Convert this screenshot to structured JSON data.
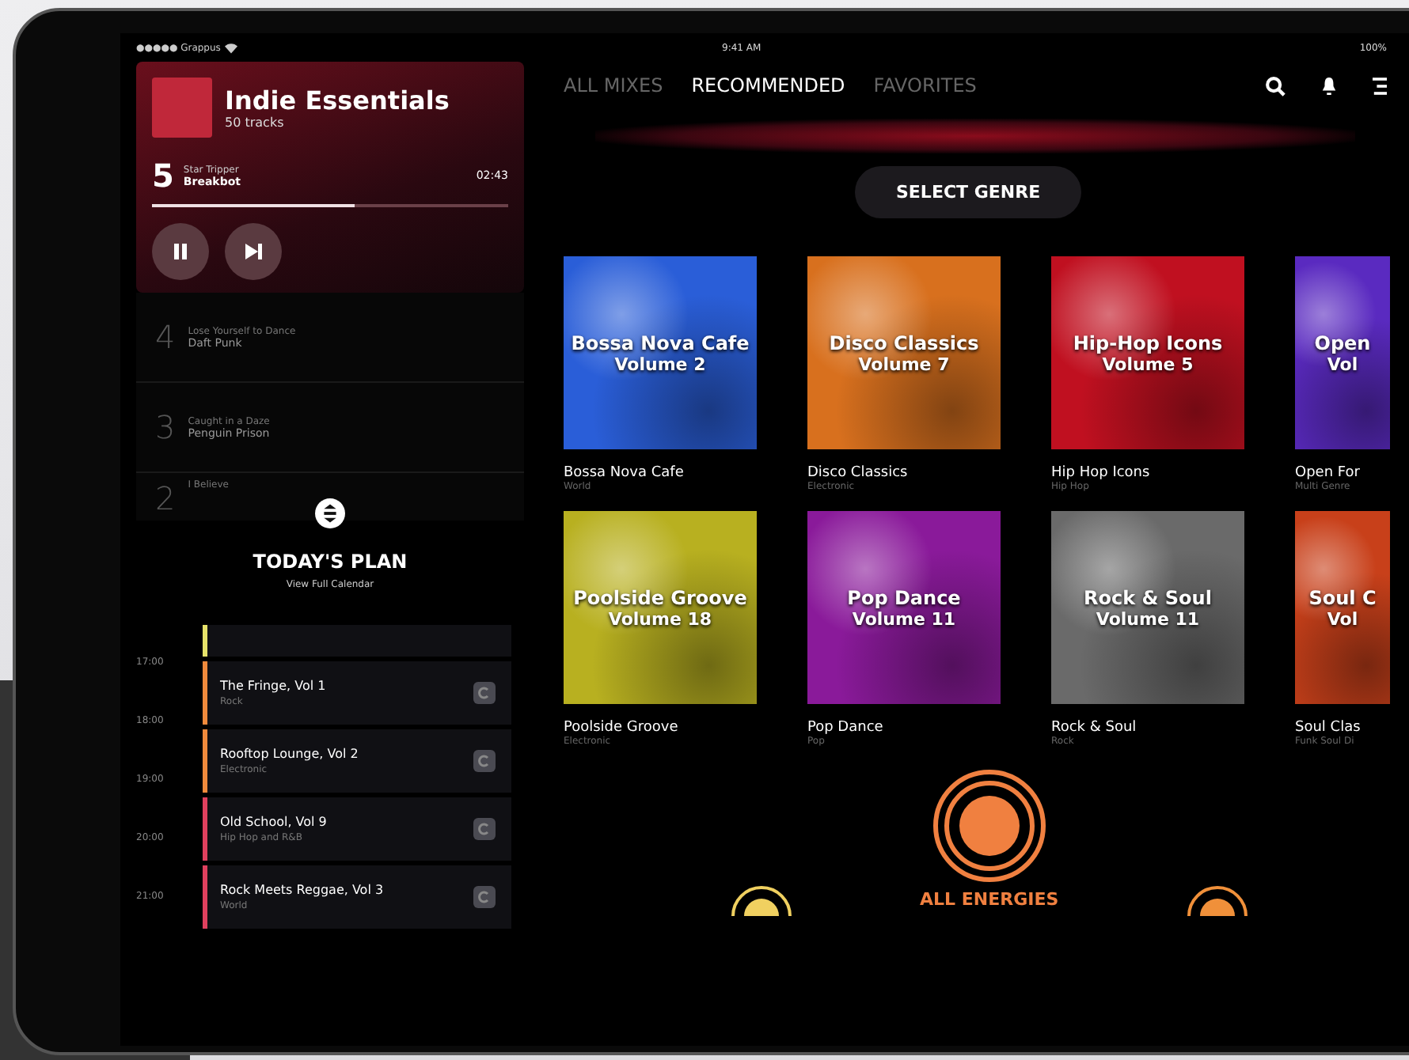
{
  "status_bar": {
    "carrier": "●●●●● Grappus",
    "time": "9:41 AM",
    "battery": "100%"
  },
  "now_playing": {
    "playlist": "Indie Essentials",
    "track_count": "50 tracks",
    "number": "5",
    "title": "Star Tripper",
    "artist": "Breakbot",
    "time": "02:43",
    "level": 0.57,
    "playing": true
  },
  "queue": [
    {
      "number": "4",
      "title": "Lose Yourself to Dance",
      "artist": "Daft Punk"
    },
    {
      "number": "3",
      "title": "Caught in a Daze",
      "artist": "Penguin Prison"
    },
    {
      "number": "2",
      "title": "I Believe"
    }
  ],
  "plan": {
    "title": "TODAY'S PLAN",
    "link": "View Full Calendar",
    "times": [
      "17:00",
      "18:00",
      "19:00",
      "20:00",
      "21:00"
    ],
    "events": [
      {
        "color": "#e6e26a"
      },
      {
        "title": "The Fringe, Vol 1",
        "genre": "Rock",
        "color": "#f08a3c"
      },
      {
        "title": "Rooftop Lounge, Vol 2",
        "genre": "Electronic",
        "color": "#f08a3c"
      },
      {
        "title": "Old School, Vol 9",
        "genre": "Hip Hop and R&B",
        "color": "#e0405e"
      },
      {
        "title": "Rock Meets Reggae, Vol 3",
        "genre": "World",
        "color": "#e0405e"
      }
    ]
  },
  "tabs": [
    {
      "label": "ALL MIXES",
      "selected": false
    },
    {
      "label": "RECOMMENDED",
      "selected": true
    },
    {
      "label": "FAVORITES",
      "selected": false
    }
  ],
  "genre_button": "SELECT GENRE",
  "mixes": [
    {
      "cover_title": "Bossa Nova Cafe",
      "cover_volume": "Volume 2",
      "name": "Bossa Nova Cafe",
      "genre": "World",
      "color": "#2a5ed8"
    },
    {
      "cover_title": "Disco Classics",
      "cover_volume": "Volume 7",
      "name": "Disco Classics",
      "genre": "Electronic",
      "color": "#d8701e"
    },
    {
      "cover_title": "Hip-Hop Icons",
      "cover_volume": "Volume 5",
      "name": "Hip Hop Icons",
      "genre": "Hip Hop",
      "color": "#c01020"
    },
    {
      "cover_title": "Open",
      "cover_volume": "Vol",
      "name": "Open For",
      "genre": "Multi Genre",
      "color": "#5a2ac0"
    },
    {
      "cover_title": "Poolside Groove",
      "cover_volume": "Volume 18",
      "name": "Poolside Groove",
      "genre": "Electronic",
      "color": "#b8b020"
    },
    {
      "cover_title": "Pop Dance",
      "cover_volume": "Volume 11",
      "name": "Pop Dance",
      "genre": "Pop",
      "color": "#8a1a9a"
    },
    {
      "cover_title": "Rock & Soul",
      "cover_volume": "Volume 11",
      "name": "Rock & Soul",
      "genre": "Rock",
      "color": "#6a6a6a"
    },
    {
      "cover_title": "Soul C",
      "cover_volume": "Vol",
      "name": "Soul Clas",
      "genre": "Funk Soul Di",
      "color": "#c8401a"
    }
  ],
  "energies": [
    {
      "color": "#f0d060",
      "selected": false
    },
    {
      "label": "ALL ENERGIES",
      "color": "#f08040",
      "selected": true
    },
    {
      "color": "#f0903a",
      "selected": false
    }
  ]
}
